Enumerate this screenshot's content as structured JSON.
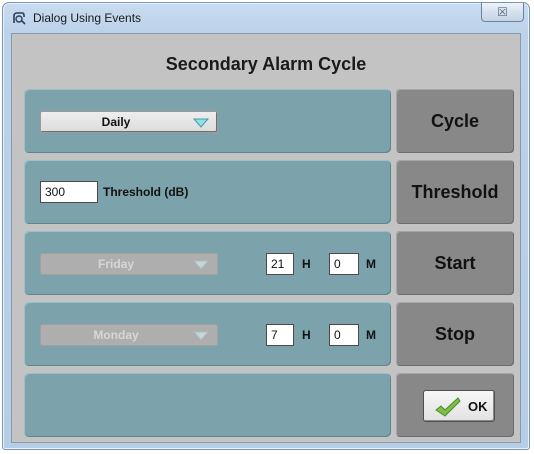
{
  "window": {
    "title": "Dialog Using Events",
    "close_glyph": "☒",
    "icon": "app-icon"
  },
  "dialog": {
    "heading": "Secondary Alarm Cycle"
  },
  "cycle_row": {
    "dropdown_value": "Daily",
    "button_label": "Cycle"
  },
  "threshold_row": {
    "value": "300",
    "label": "Threshold (dB)",
    "button_label": "Threshold"
  },
  "start_row": {
    "day_value": "Friday",
    "hour_value": "21",
    "hour_unit": "H",
    "minute_value": "0",
    "minute_unit": "M",
    "button_label": "Start"
  },
  "stop_row": {
    "day_value": "Monday",
    "hour_value": "7",
    "hour_unit": "H",
    "minute_value": "0",
    "minute_unit": "M",
    "button_label": "Stop"
  },
  "ok_button": {
    "label": "OK",
    "icon": "checkmark-icon"
  },
  "colors": {
    "panel": "#7ca3ab",
    "side_button": "#888888",
    "client_bg": "#c3c3c3",
    "arrow": "#8fe0e8"
  }
}
